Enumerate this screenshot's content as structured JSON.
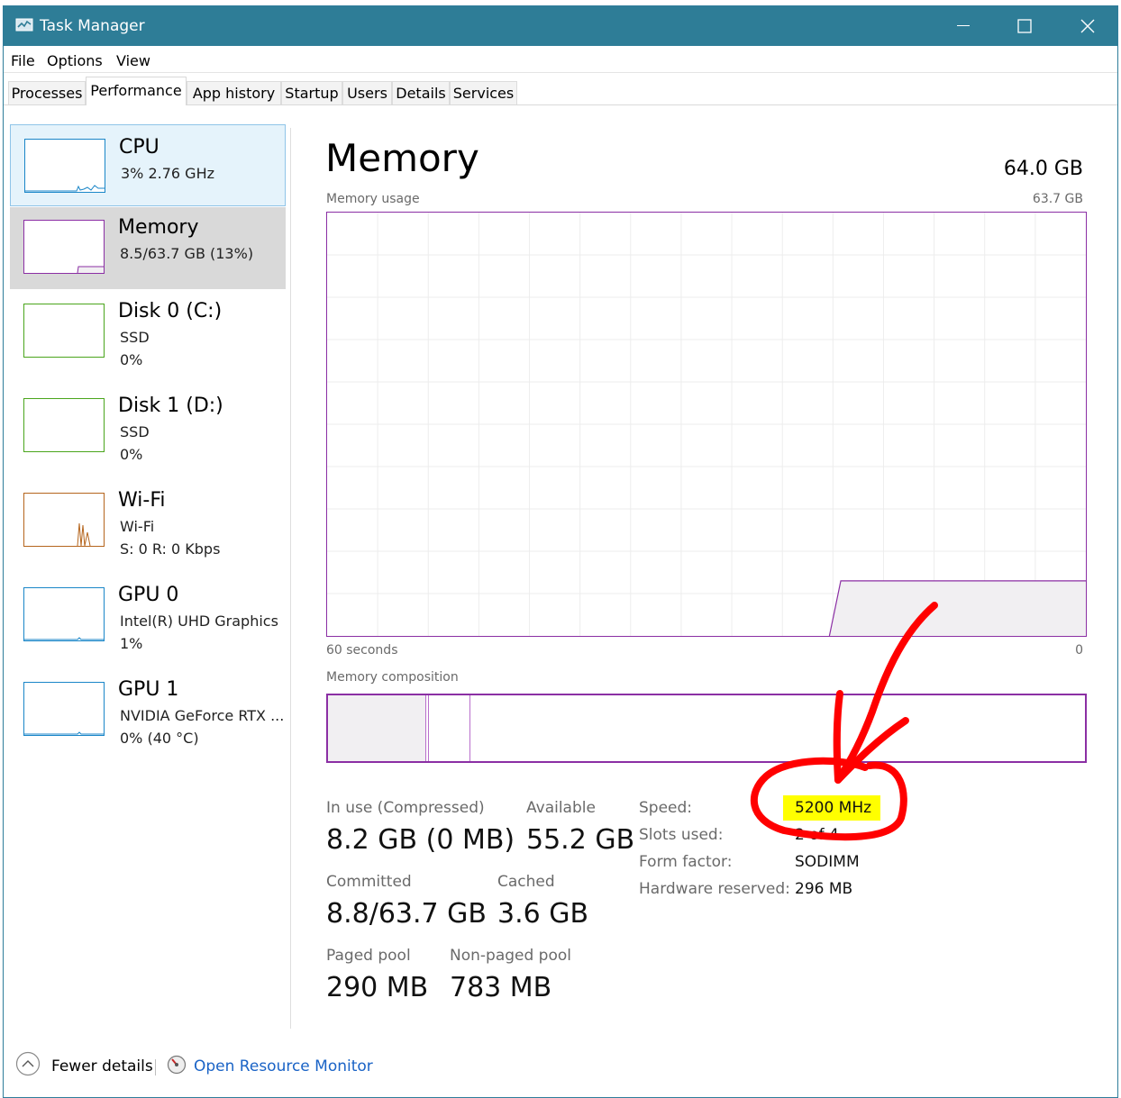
{
  "window": {
    "title": "Task Manager"
  },
  "menu": [
    "File",
    "Options",
    "View"
  ],
  "tabs": [
    "Processes",
    "Performance",
    "App history",
    "Startup",
    "Users",
    "Details",
    "Services"
  ],
  "sidebar": [
    {
      "title": "CPU",
      "line1": "3%  2.76 GHz",
      "line2": "",
      "graph_color": "#1a86c8"
    },
    {
      "title": "Memory",
      "line1": "8.5/63.7 GB (13%)",
      "line2": "",
      "graph_color": "#8b2fa4"
    },
    {
      "title": "Disk 0 (C:)",
      "line1": "SSD",
      "line2": "0%",
      "graph_color": "#4aa51c"
    },
    {
      "title": "Disk 1 (D:)",
      "line1": "SSD",
      "line2": "0%",
      "graph_color": "#4aa51c"
    },
    {
      "title": "Wi-Fi",
      "line1": "Wi-Fi",
      "line2": "S: 0  R: 0 Kbps",
      "graph_color": "#b5651d"
    },
    {
      "title": "GPU 0",
      "line1": "Intel(R) UHD Graphics",
      "line2": "1%",
      "graph_color": "#1a86c8"
    },
    {
      "title": "GPU 1",
      "line1": "NVIDIA GeForce RTX ...",
      "line2": "0% (40 °C)",
      "graph_color": "#1a86c8"
    }
  ],
  "main": {
    "title": "Memory",
    "total": "64.0 GB",
    "usage_label": "Memory usage",
    "usage_max": "63.7 GB",
    "time_left": "60 seconds",
    "time_right": "0",
    "composition_label": "Memory composition",
    "usage_fraction": 0.13,
    "composition": {
      "in_use_fraction": 0.13,
      "modified_fraction": 0.003,
      "standby_fraction": 0.055
    }
  },
  "stats": {
    "in_use_label": "In use (Compressed)",
    "in_use_value": "8.2 GB (0 MB)",
    "available_label": "Available",
    "available_value": "55.2 GB",
    "committed_label": "Committed",
    "committed_value": "8.8/63.7 GB",
    "cached_label": "Cached",
    "cached_value": "3.6 GB",
    "paged_label": "Paged pool",
    "paged_value": "290 MB",
    "nonpaged_label": "Non-paged pool",
    "nonpaged_value": "783 MB"
  },
  "details": {
    "speed_label": "Speed:",
    "speed_value": "5200 MHz",
    "slots_label": "Slots used:",
    "slots_value": "2 of 4",
    "form_label": "Form factor:",
    "form_value": "SODIMM",
    "reserved_label": "Hardware reserved:",
    "reserved_value": "296 MB"
  },
  "footer": {
    "fewer_details": "Fewer details",
    "resource_monitor": "Open Resource Monitor"
  },
  "colors": {
    "titlebar": "#2e7d97",
    "memory_accent": "#8b2fa4",
    "annotation": "#ff0000",
    "highlight": "#ffff00",
    "link": "#1a63c6"
  }
}
